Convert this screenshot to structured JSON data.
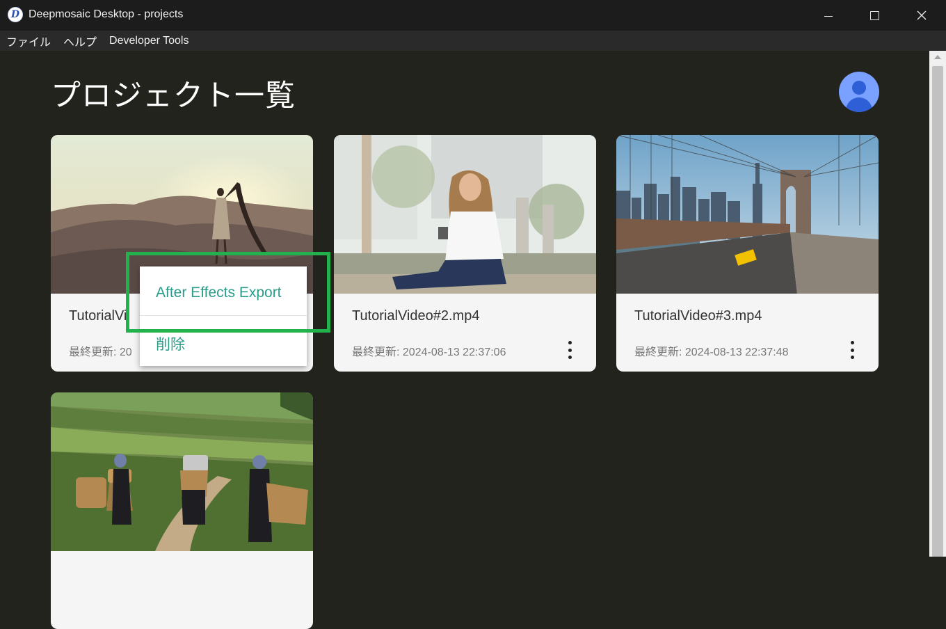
{
  "window": {
    "title": "Deepmosaic Desktop - projects",
    "icon_letter": "D"
  },
  "menubar": {
    "items": [
      "ファイル",
      "ヘルプ",
      "Developer Tools"
    ]
  },
  "page": {
    "title": "プロジェクト一覧"
  },
  "cards": [
    {
      "name": "TutorialVi",
      "updated": "最終更新: 20",
      "thumbnail": "desert-woman-scarf"
    },
    {
      "name": "TutorialVideo#2.mp4",
      "updated": "最終更新: 2024-08-13 22:37:06",
      "thumbnail": "woman-phone-sitting"
    },
    {
      "name": "TutorialVideo#3.mp4",
      "updated": "最終更新: 2024-08-13 22:37:48",
      "thumbnail": "brooklyn-bridge-taxi"
    },
    {
      "thumbnail": "terrace-field-workers"
    }
  ],
  "context_menu": {
    "items": [
      "After Effects Export",
      "削除"
    ]
  },
  "colors": {
    "background": "#23231e",
    "card": "#f5f5f5",
    "accent_teal": "#2a9d8a",
    "highlight_green": "#22b14c",
    "avatar": "#7aa1ff"
  }
}
